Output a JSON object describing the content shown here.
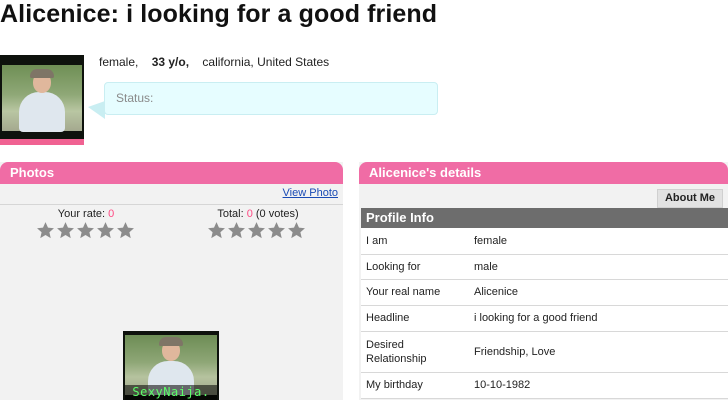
{
  "profile": {
    "title": "Alicenice: i looking for a good friend",
    "gender": "female,",
    "age": "33 y/o,",
    "location": "california, United States",
    "status_label": "Status:"
  },
  "photos_panel": {
    "header": "Photos",
    "view_photo_link": "View Photo",
    "your_rate_label": "Your rate: ",
    "your_rate_value": "0",
    "total_label": "Total: ",
    "total_value": "0",
    "total_votes": " (0 votes)",
    "your_stars_filled": 0,
    "total_stars_filled": 0,
    "stars_max": 5,
    "thumbnail_watermark": "SexyNaija."
  },
  "details_panel": {
    "header": "Alicenice's details",
    "about_me_button": "About Me",
    "profile_info_header": "Profile Info",
    "rows": [
      {
        "label": "I am",
        "value": "female"
      },
      {
        "label": "Looking for",
        "value": "male"
      },
      {
        "label": "Your real name",
        "value": "Alicenice"
      },
      {
        "label": "Headline",
        "value": "i looking for a good friend"
      },
      {
        "label": "Desired Relationship",
        "value": "Friendship, Love"
      },
      {
        "label": "My birthday",
        "value": "10-10-1982"
      }
    ]
  },
  "colors": {
    "panel_header": "#f06ca5",
    "accent_pink": "#ff4a84",
    "status_bubble": "#e6fdff",
    "profile_info_bar": "#6d6d6d",
    "star_empty": "#8c8c8c",
    "link": "#1a4bb5"
  },
  "icons": {
    "rating_star": "star-icon"
  }
}
